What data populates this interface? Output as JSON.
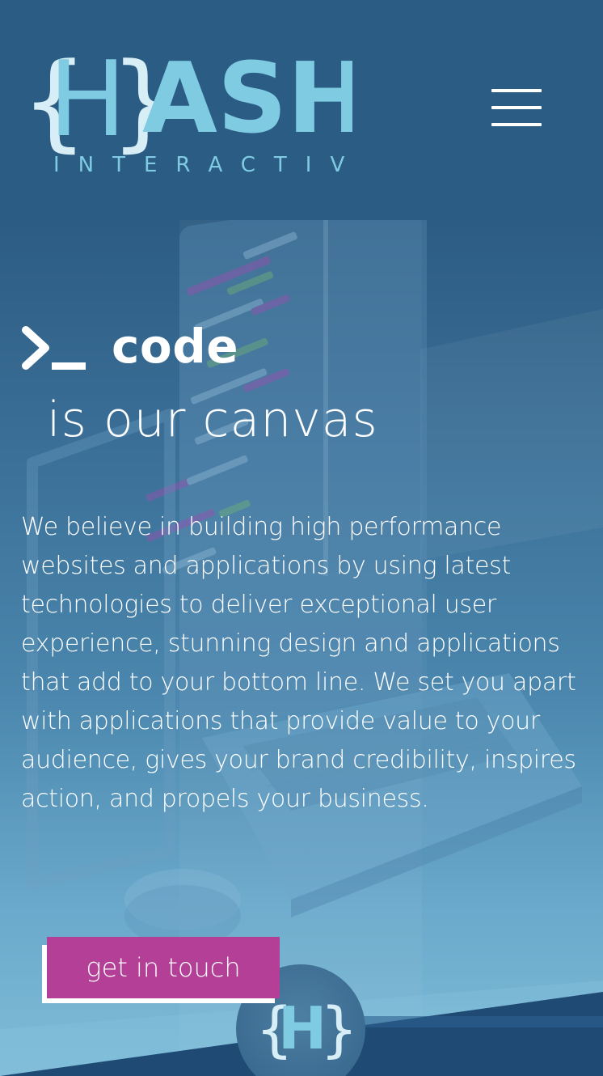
{
  "header": {
    "logo": {
      "brace_open": "{",
      "letter": "H",
      "brace_close": "}",
      "wordmark": "ASH",
      "tagline": "INTERACTIVE"
    },
    "menu_icon": "hamburger-menu-icon"
  },
  "hero": {
    "prompt_icon": "terminal-prompt-icon",
    "headline_code": "code",
    "headline_rest": "is our canvas",
    "description": "We believe in building high performance websites and applications by using latest technologies to deliver exceptional user experience, stunning design and applications that add to your bottom line. We set you apart with applications that provide value to your audience, gives your brand credibility, inspires action, and propels your business.",
    "cta_label": "get in touch"
  },
  "badge": {
    "brace_open": "{",
    "letter": "H",
    "brace_close": "}"
  },
  "colors": {
    "header_bg": "#2b5c84",
    "logo_light": "#7ecbe2",
    "logo_pale": "#d8eef6",
    "cta_bg": "#b43f96",
    "text": "#ffffff",
    "bottom_band": "#1e4a74"
  }
}
